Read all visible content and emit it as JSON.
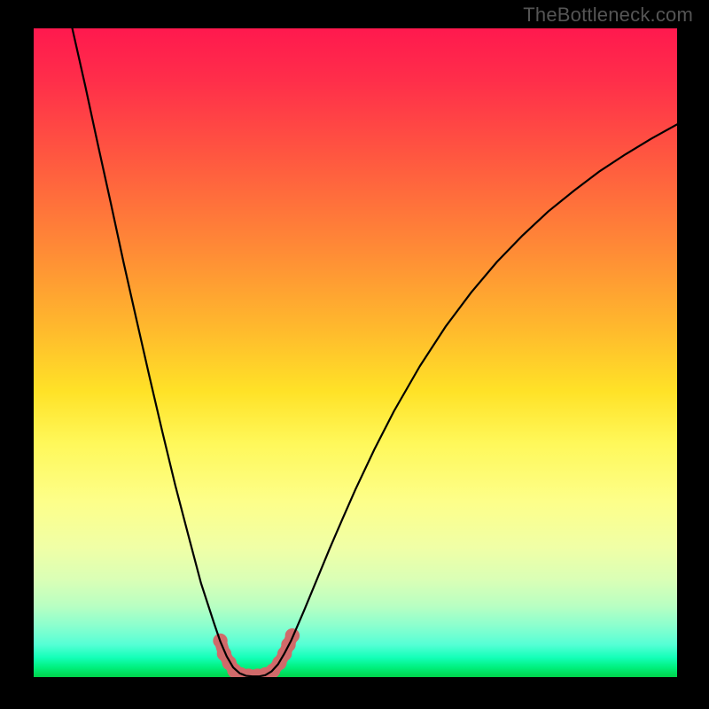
{
  "watermark": "TheBottleneck.com",
  "chart_data": {
    "type": "line",
    "title": "",
    "xlabel": "",
    "ylabel": "",
    "xlim": [
      0,
      100
    ],
    "ylim": [
      0,
      100
    ],
    "curve": {
      "name": "bottleneck-curve",
      "points": [
        {
          "x": 6.0,
          "y": 100.0
        },
        {
          "x": 8.0,
          "y": 91.2
        },
        {
          "x": 10.0,
          "y": 82.0
        },
        {
          "x": 12.0,
          "y": 73.0
        },
        {
          "x": 14.0,
          "y": 63.8
        },
        {
          "x": 16.0,
          "y": 55.0
        },
        {
          "x": 18.0,
          "y": 46.3
        },
        {
          "x": 20.0,
          "y": 37.8
        },
        {
          "x": 22.0,
          "y": 29.6
        },
        {
          "x": 24.0,
          "y": 22.0
        },
        {
          "x": 26.0,
          "y": 14.5
        },
        {
          "x": 28.0,
          "y": 8.4
        },
        {
          "x": 29.0,
          "y": 5.5
        },
        {
          "x": 30.0,
          "y": 3.2
        },
        {
          "x": 31.0,
          "y": 1.5
        },
        {
          "x": 32.0,
          "y": 0.6
        },
        {
          "x": 33.0,
          "y": 0.2
        },
        {
          "x": 34.0,
          "y": 0.1
        },
        {
          "x": 35.0,
          "y": 0.1
        },
        {
          "x": 36.0,
          "y": 0.3
        },
        {
          "x": 37.0,
          "y": 0.9
        },
        {
          "x": 38.0,
          "y": 2.0
        },
        {
          "x": 39.0,
          "y": 3.7
        },
        {
          "x": 40.0,
          "y": 5.6
        },
        {
          "x": 42.0,
          "y": 10.2
        },
        {
          "x": 44.0,
          "y": 15.0
        },
        {
          "x": 46.0,
          "y": 19.8
        },
        {
          "x": 48.0,
          "y": 24.4
        },
        {
          "x": 50.0,
          "y": 28.9
        },
        {
          "x": 53.0,
          "y": 35.2
        },
        {
          "x": 56.0,
          "y": 41.0
        },
        {
          "x": 60.0,
          "y": 47.9
        },
        {
          "x": 64.0,
          "y": 54.0
        },
        {
          "x": 68.0,
          "y": 59.3
        },
        {
          "x": 72.0,
          "y": 64.0
        },
        {
          "x": 76.0,
          "y": 68.1
        },
        {
          "x": 80.0,
          "y": 71.8
        },
        {
          "x": 84.0,
          "y": 75.0
        },
        {
          "x": 88.0,
          "y": 78.0
        },
        {
          "x": 92.0,
          "y": 80.6
        },
        {
          "x": 96.0,
          "y": 83.0
        },
        {
          "x": 100.0,
          "y": 85.2
        }
      ]
    },
    "threshold_markers": {
      "name": "bottleneck-zone-markers",
      "color": "#d06a6a",
      "points": [
        {
          "x": 29.0,
          "y": 5.6
        },
        {
          "x": 29.6,
          "y": 3.6
        },
        {
          "x": 30.4,
          "y": 2.2
        },
        {
          "x": 31.2,
          "y": 1.0
        },
        {
          "x": 32.2,
          "y": 0.4
        },
        {
          "x": 33.4,
          "y": 0.2
        },
        {
          "x": 34.8,
          "y": 0.2
        },
        {
          "x": 36.0,
          "y": 0.4
        },
        {
          "x": 37.2,
          "y": 1.0
        },
        {
          "x": 38.2,
          "y": 2.2
        },
        {
          "x": 39.0,
          "y": 3.6
        },
        {
          "x": 39.6,
          "y": 5.0
        },
        {
          "x": 40.2,
          "y": 6.4
        }
      ]
    }
  }
}
